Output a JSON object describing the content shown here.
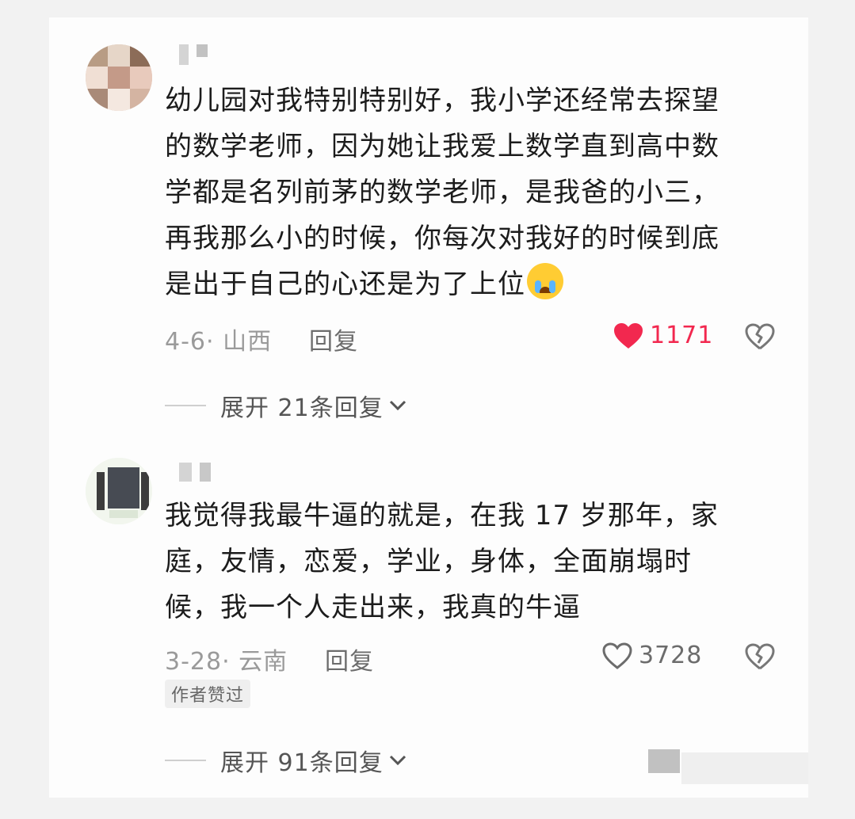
{
  "comments": [
    {
      "text_lines": [
        "幼儿园对我特别特别好，我小学还经常去探望",
        "的数学老师，因为她让我爱上数学直到高中数",
        "学都是名列前茅的数学老师，是我爸的小三，",
        "再我那么小的时候，你每次对我好的时候到底",
        "是出于自己的心还是为了上位"
      ],
      "emoji": "crying-face",
      "meta": "4-6· 山西",
      "reply_label": "回复",
      "likes": "1171",
      "liked": true,
      "expand_label": "展开 21条回复"
    },
    {
      "text_lines": [
        "我觉得我最牛逼的就是，在我 17 岁那年，家",
        "庭，友情，恋爱，学业，身体，全面崩塌时",
        "候，我一个人走出来，我真的牛逼"
      ],
      "meta": "3-28· 云南",
      "reply_label": "回复",
      "likes": "3728",
      "liked": false,
      "badge": "作者赞过",
      "expand_label": "展开 91条回复"
    }
  ],
  "colors": {
    "like_red": "#f2284f",
    "text": "#1c1c1c",
    "meta": "#9a9a9a"
  }
}
